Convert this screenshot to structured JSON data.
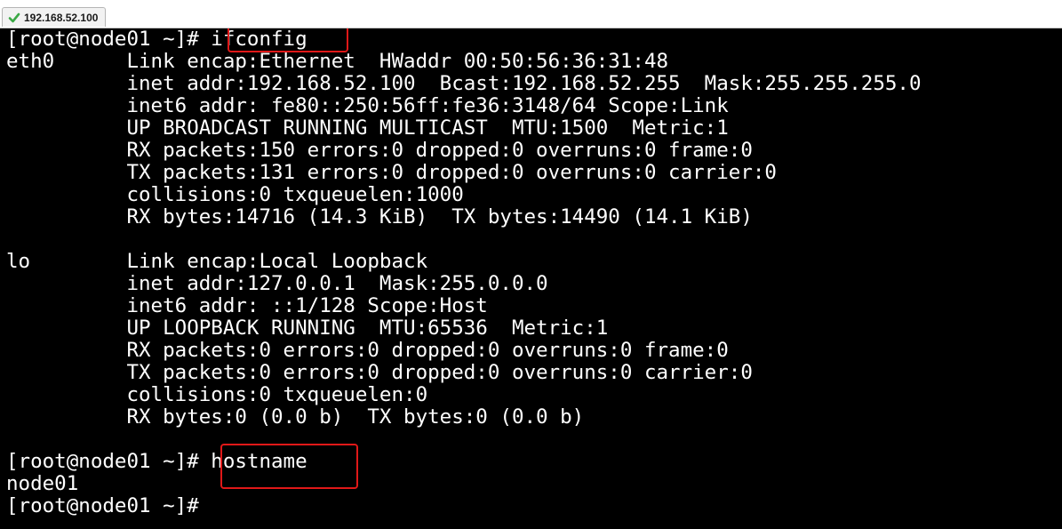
{
  "tab": {
    "label": "192.168.52.100",
    "icon": "checkmark-icon",
    "icon_color": "#3aa845"
  },
  "terminal": {
    "colors": {
      "background": "#000000",
      "text": "#ffffff",
      "highlight": "#e01818"
    },
    "lines": [
      "[root@node01 ~]# ifconfig",
      "eth0      Link encap:Ethernet  HWaddr 00:50:56:36:31:48",
      "          inet addr:192.168.52.100  Bcast:192.168.52.255  Mask:255.255.255.0",
      "          inet6 addr: fe80::250:56ff:fe36:3148/64 Scope:Link",
      "          UP BROADCAST RUNNING MULTICAST  MTU:1500  Metric:1",
      "          RX packets:150 errors:0 dropped:0 overruns:0 frame:0",
      "          TX packets:131 errors:0 dropped:0 overruns:0 carrier:0",
      "          collisions:0 txqueuelen:1000",
      "          RX bytes:14716 (14.3 KiB)  TX bytes:14490 (14.1 KiB)",
      "",
      "lo        Link encap:Local Loopback",
      "          inet addr:127.0.0.1  Mask:255.0.0.0",
      "          inet6 addr: ::1/128 Scope:Host",
      "          UP LOOPBACK RUNNING  MTU:65536  Metric:1",
      "          RX packets:0 errors:0 dropped:0 overruns:0 frame:0",
      "          TX packets:0 errors:0 dropped:0 overruns:0 carrier:0",
      "          collisions:0 txqueuelen:0",
      "          RX bytes:0 (0.0 b)  TX bytes:0 (0.0 b)",
      "",
      "[root@node01 ~]# hostname",
      "node01",
      "[root@node01 ~]#"
    ],
    "highlighted_commands": [
      "ifconfig",
      "hostname"
    ]
  }
}
